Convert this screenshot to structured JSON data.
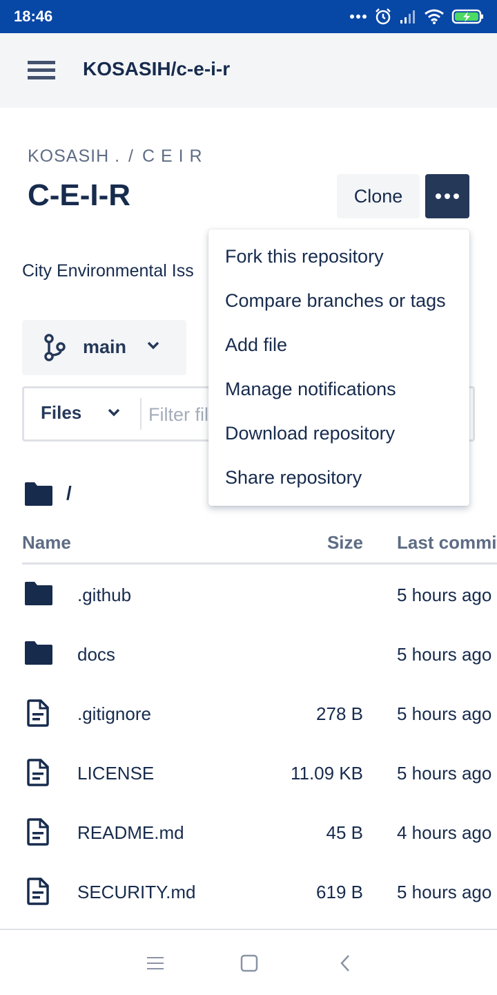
{
  "status_bar": {
    "time": "18:46",
    "icons": [
      "more-dots-icon",
      "alarm-icon",
      "signal-icon",
      "wifi-icon",
      "battery-charging-icon"
    ]
  },
  "header": {
    "title": "KOSASIH/c-e-i-r",
    "menu_icon": "hamburger-menu-icon"
  },
  "breadcrumb": {
    "owner": "KOSASIH .",
    "separator": "/",
    "repo": "C E I R"
  },
  "repo": {
    "title": "C-E-I-R",
    "description": "City Environmental Iss"
  },
  "actions": {
    "clone_label": "Clone",
    "more_icon": "more-horizontal-icon"
  },
  "dropdown_menu": {
    "items": [
      "Fork this repository",
      "Compare branches or tags",
      "Add file",
      "Manage notifications",
      "Download repository",
      "Share repository"
    ]
  },
  "branch": {
    "label": "main",
    "icon": "branch-icon"
  },
  "filter": {
    "files_label": "Files",
    "placeholder": "Filter files"
  },
  "path": {
    "label": "/"
  },
  "table": {
    "columns": {
      "name": "Name",
      "size": "Size",
      "last_commit": "Last commit"
    },
    "rows": [
      {
        "type": "folder",
        "name": ".github",
        "size": "",
        "last_commit": "5 hours ago"
      },
      {
        "type": "folder",
        "name": "docs",
        "size": "",
        "last_commit": "5 hours ago"
      },
      {
        "type": "file",
        "name": ".gitignore",
        "size": "278 B",
        "last_commit": "5 hours ago"
      },
      {
        "type": "file",
        "name": "LICENSE",
        "size": "11.09 KB",
        "last_commit": "5 hours ago"
      },
      {
        "type": "file",
        "name": "README.md",
        "size": "45 B",
        "last_commit": "4 hours ago"
      },
      {
        "type": "file",
        "name": "SECURITY.md",
        "size": "619 B",
        "last_commit": "5 hours ago"
      }
    ]
  },
  "colors": {
    "status_bar": "#0747a6",
    "primary_dark": "#253858",
    "text": "#172b4d",
    "muted": "#5e6c84"
  }
}
